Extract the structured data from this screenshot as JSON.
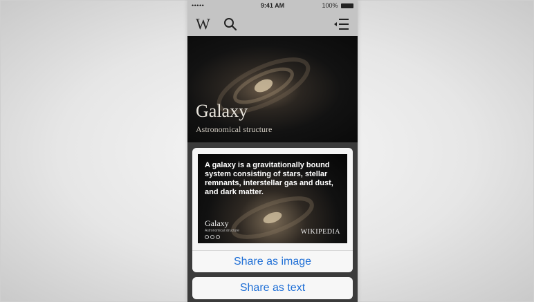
{
  "statusbar": {
    "carrier": "••••• ",
    "time": "9:41 AM",
    "battery_text": "100%"
  },
  "toolbar": {
    "logo": "W",
    "icons": [
      "search-icon",
      "table-of-contents-icon"
    ]
  },
  "article": {
    "title": "Galaxy",
    "subtitle": "Astronomical structure"
  },
  "share_card": {
    "quote": "A galaxy is a gravitationally bound system consisting of stars, stellar remnants, interstellar gas and dust, and dark matter.",
    "title": "Galaxy",
    "subtitle": "Astronomical structure",
    "wordmark": "WIKIPEDIA"
  },
  "actions": {
    "share_image": "Share as image",
    "share_text": "Share as text"
  },
  "colors": {
    "accent": "#1f6fd6",
    "toolbar_bg": "#c4c4c4"
  }
}
